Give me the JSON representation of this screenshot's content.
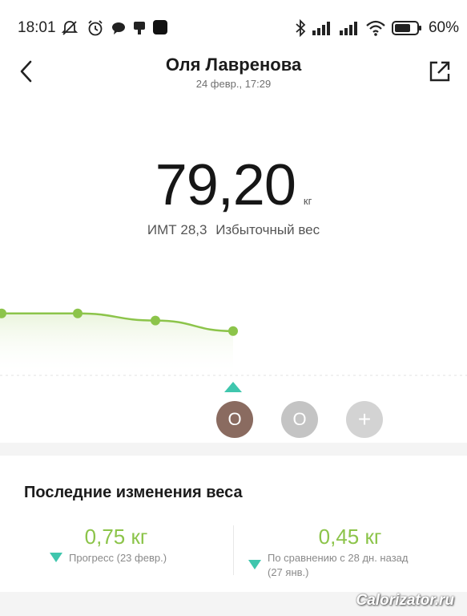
{
  "status_bar": {
    "time": "18:01",
    "battery": "60%",
    "icons": [
      "muted-bell-icon",
      "alarm-icon",
      "chat-icon",
      "notification-icon",
      "app-icon",
      "bluetooth-icon",
      "signal-icon",
      "signal-icon",
      "wifi-icon",
      "battery-icon"
    ]
  },
  "header": {
    "name": "Оля Лавренова",
    "date": "24 февр., 17:29",
    "back_icon": "chevron-left-icon",
    "share_icon": "share-icon"
  },
  "measurement": {
    "weight": "79,20",
    "unit": "кг",
    "bmi_label": "ИМТ 28,3",
    "bmi_status": "Избыточный вес"
  },
  "chart_data": {
    "type": "line",
    "color": "#8cc44a",
    "series": [
      {
        "values": [
          79.95,
          79.95,
          79.65,
          79.2
        ]
      }
    ]
  },
  "users": {
    "user1": "О",
    "user2": "О",
    "add": "+"
  },
  "changes": {
    "title": "Последние изменения веса",
    "left": {
      "value": "0,75 кг",
      "desc": "Прогресс (23 февр.)"
    },
    "right": {
      "value": "0,45 кг",
      "desc_line1": "По сравнению с 28 дн. назад",
      "desc_line2": "(27 янв.)"
    }
  },
  "watermark": "Calorizator.ru",
  "colors": {
    "accent_green": "#8cc44a",
    "accent_teal": "#3fc6ad",
    "user1": "#8a6b60"
  }
}
